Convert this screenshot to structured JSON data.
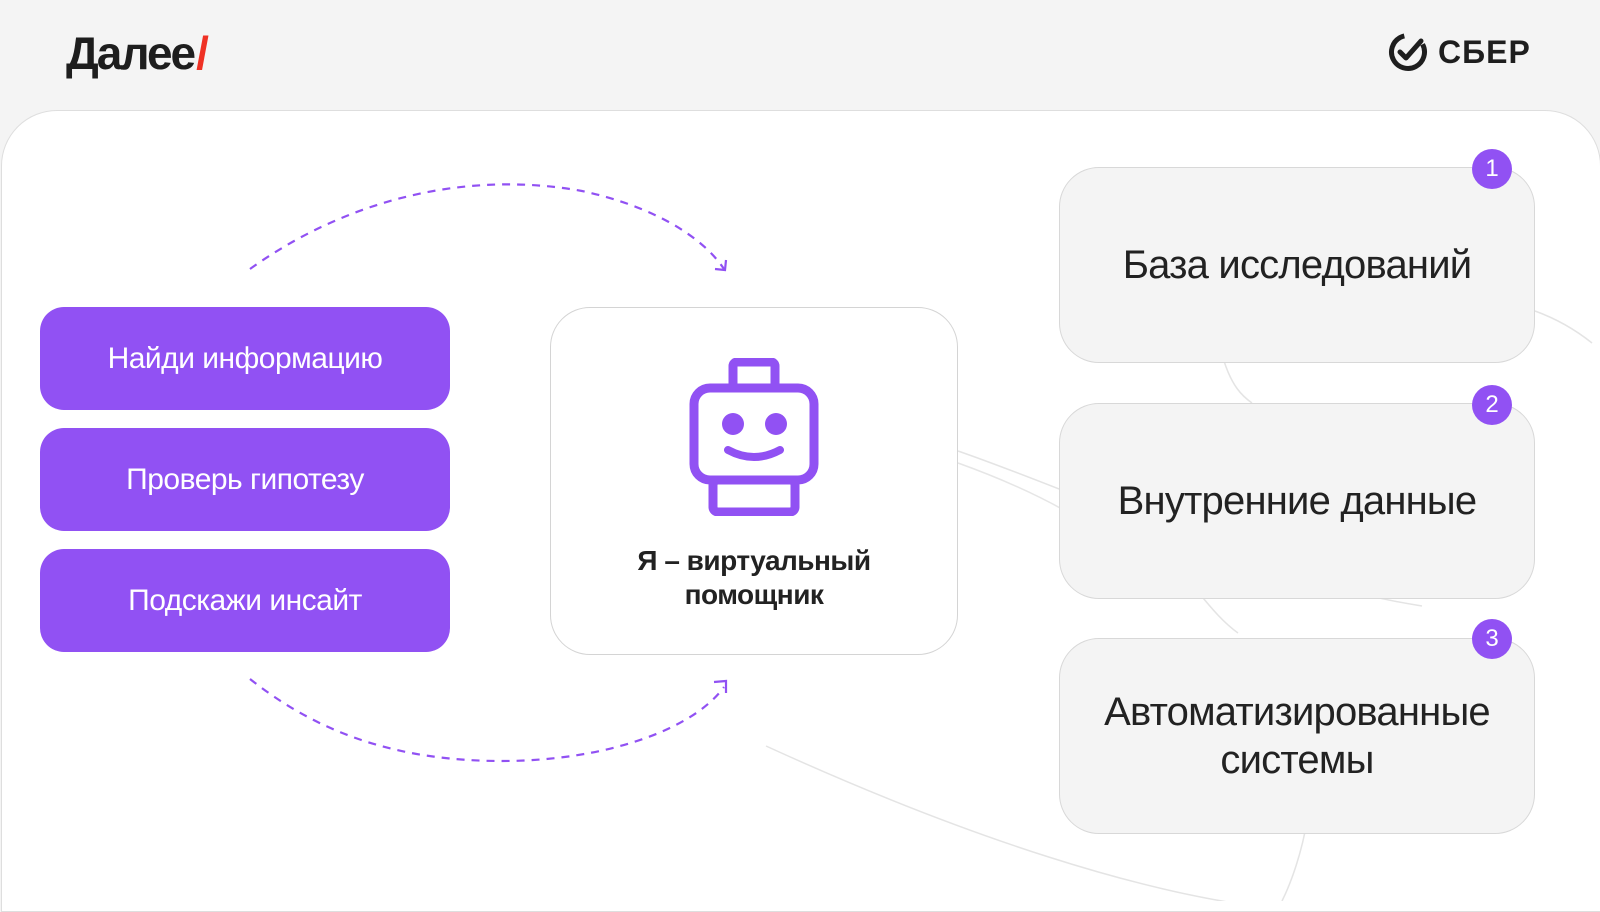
{
  "header": {
    "logo_left_text": "Далее",
    "logo_left_slash": "/",
    "logo_right_text": "СБЕР",
    "logo_right_icon": "sber-check-icon"
  },
  "commands": [
    {
      "label": "Найди информацию"
    },
    {
      "label": "Проверь гипотезу"
    },
    {
      "label": "Подскажи инсайт"
    }
  ],
  "assistant": {
    "icon": "robot-icon",
    "label_line1": "Я – виртуальный",
    "label_line2": "помощник"
  },
  "sources": [
    {
      "badge": "1",
      "label_line1": "База исследований",
      "label_line2": ""
    },
    {
      "badge": "2",
      "label_line1": "Внутренние данные",
      "label_line2": ""
    },
    {
      "badge": "3",
      "label_line1": "Автоматизированные",
      "label_line2": "системы"
    }
  ],
  "colors": {
    "accent": "#9151f3",
    "logo_slash": "#ef3124",
    "text": "#222222",
    "card_bg": "#f4f4f4"
  }
}
